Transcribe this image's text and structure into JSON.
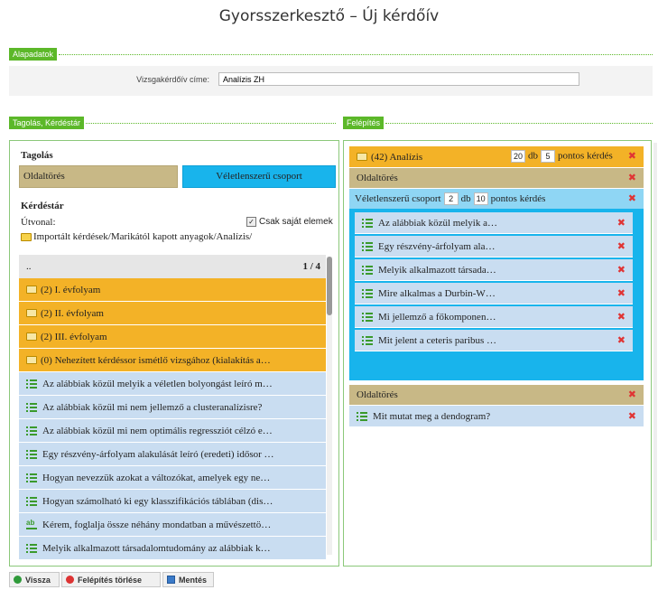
{
  "page": {
    "title": "Gyorsszerkesztő – Új kérdőív"
  },
  "sections": {
    "basics": "Alapadatok",
    "tagolas_kerdestar": "Tagolás, Kérdéstár",
    "felepites": "Felépítés"
  },
  "basics": {
    "label": "Vizsgakérdőív címe:",
    "value": "Analízis ZH"
  },
  "left": {
    "tagolas_title": "Tagolás",
    "oldaltores": "Oldaltörés",
    "veletlen": "Véletlenszerű csoport",
    "kerdestar_title": "Kérdéstár",
    "utvonal_label": "Útvonal:",
    "checkbox_label": "Csak saját elemek",
    "path": "Importált kérdések/Marikától kapott anyagok/Analízis/",
    "list_up": "..",
    "pager": "1 / 4",
    "folders": [
      "(2) I. évfolyam",
      "(2) II. évfolyam",
      "(2) III. évfolyam",
      "(0) Nehezített kérdéssor ismétlő vizsgához (kialakítás a…"
    ],
    "questions": [
      "Az alábbiak közül melyik a véletlen bolyongást leíró m…",
      "Az alábbiak közül mi nem jellemző a clusteranalízisre?",
      "Az alábbiak közül mi nem optimális regressziót célzó e…",
      "Egy részvény-árfolyam alakulását leíró (eredeti) idősor …",
      "Hogyan nevezzük azokat a változókat, amelyek egy ne…",
      "Hogyan számolható ki egy klasszifikációs táblában (dis…",
      "Kérem, foglalja össze néhány mondatban a művészettö…",
      "Melyik alkalmazott társadalomtudomány az alábbiak k…"
    ]
  },
  "right": {
    "header_label": "(42) Analízis",
    "header_count": "20",
    "db": "db",
    "header_points": "5",
    "pontos": "pontos kérdés",
    "oldaltores1": "Oldaltörés",
    "group_label": "Véletlenszerű csoport",
    "group_count": "2",
    "group_points": "10",
    "group_items": [
      "Az alábbiak közül melyik a…",
      "Egy részvény-árfolyam ala…",
      "Melyik alkalmazott társada…",
      "Mire alkalmas a Durbin-W…",
      "Mi jellemző a főkomponen…",
      "Mit jelent a ceteris paribus …"
    ],
    "oldaltores2": "Oldaltörés",
    "last_question": "Mit mutat meg a dendogram?"
  },
  "buttons": {
    "back": "Vissza",
    "delete": "Felépítés törlése",
    "save": "Mentés"
  },
  "colors": {
    "green": "#5cb829",
    "orange": "#f3b227",
    "blue": "#18b4ec",
    "tan": "#c8b886",
    "red": "#e03434"
  }
}
